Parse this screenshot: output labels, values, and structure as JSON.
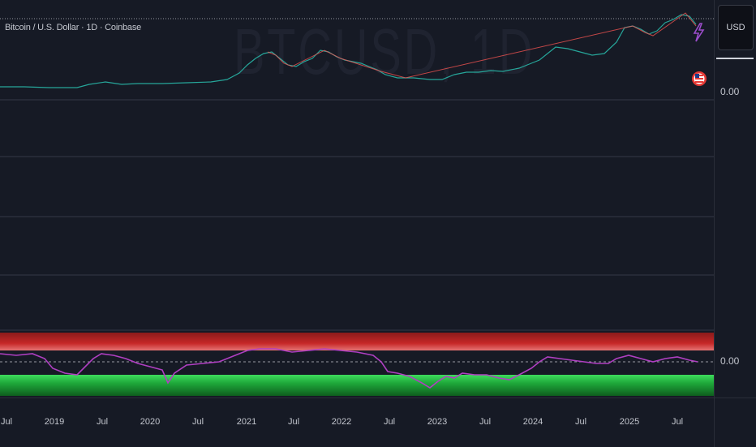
{
  "legend": {
    "title": "Bitcoin / U.S. Dollar · 1D · Coinbase"
  },
  "watermark": "BTCUSD, 1D",
  "price_scale": {
    "currency_button": "USD",
    "top_label": "0.00",
    "osc_label": "0.00"
  },
  "time_axis": {
    "ticks": [
      "Jul",
      "2019",
      "Jul",
      "2020",
      "Jul",
      "2021",
      "Jul",
      "2022",
      "Jul",
      "2023",
      "Jul",
      "2024",
      "Jul",
      "2025",
      "Jul"
    ]
  },
  "icons": {
    "alert": "lightning-bolt-icon",
    "flag": "us-flag-icon"
  },
  "colors": {
    "background": "#161a25",
    "up": "#26a69a",
    "down": "#ef5350",
    "oscillator": "#b03fc2",
    "overbought": "#b71c1c",
    "oversold": "#1b8f2a"
  }
}
